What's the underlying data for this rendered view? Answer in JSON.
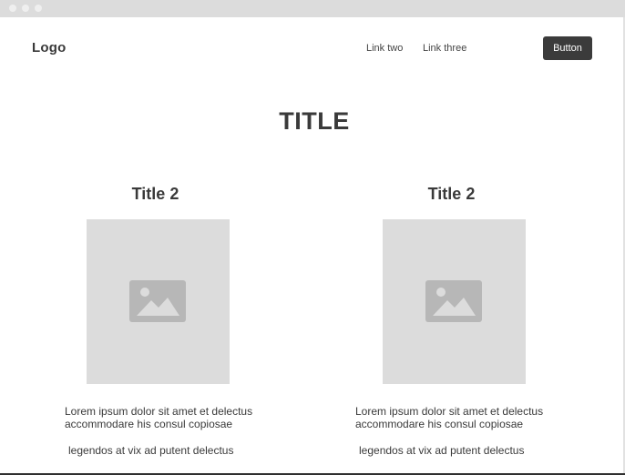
{
  "nav": {
    "logo": "Logo",
    "links": [
      "Link two",
      "Link three"
    ],
    "button_label": "Button"
  },
  "hero": {
    "title": "TITLE"
  },
  "columns": [
    {
      "title": "Title 2",
      "image_icon": "image-placeholder-icon",
      "text": "Lorem ipsum dolor sit amet et delectus accommodare his consul copiosae",
      "text2": "legendos at vix ad putent delectus"
    },
    {
      "title": "Title 2",
      "image_icon": "image-placeholder-icon",
      "text": "Lorem ipsum dolor sit amet et delectus accommodare his consul copiosae",
      "text2": "legendos at vix ad putent delectus"
    }
  ],
  "colors": {
    "placeholder_bg": "#dcdcdc",
    "placeholder_icon": "#b7b7b7",
    "button_bg": "#3b3b3b",
    "text": "#3a3a3a"
  }
}
